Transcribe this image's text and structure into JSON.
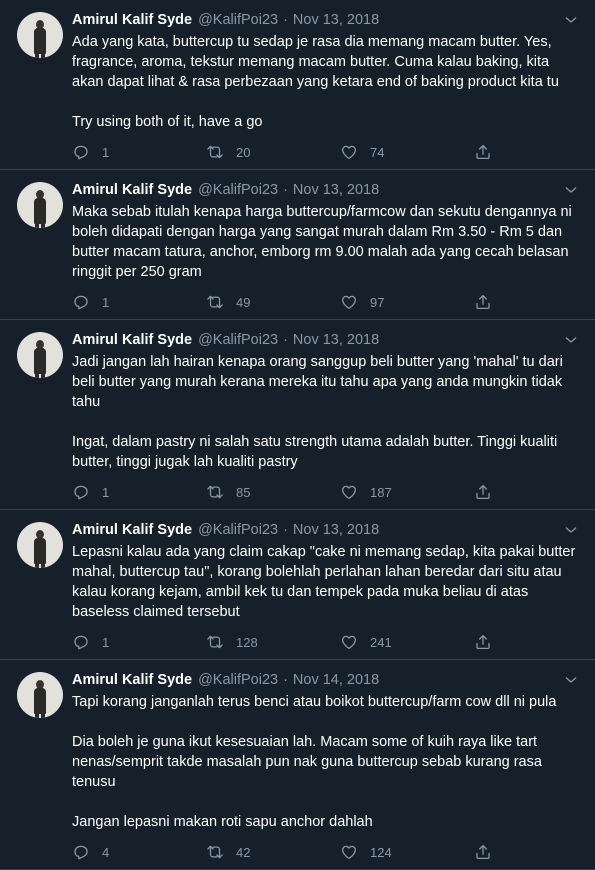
{
  "tweets": [
    {
      "name": "Amirul Kalif Syde",
      "handle": "@KalifPoi23",
      "date": "Nov 13, 2018",
      "paragraphs": [
        "Ada yang kata, buttercup tu sedap je rasa dia memang macam butter. Yes, fragrance, aroma, tekstur memang macam butter. Cuma kalau baking, kita akan dapat lihat & rasa perbezaan yang ketara end of baking product kita tu",
        "Try using both of it, have a go"
      ],
      "replies": "1",
      "retweets": "20",
      "likes": "74"
    },
    {
      "name": "Amirul Kalif Syde",
      "handle": "@KalifPoi23",
      "date": "Nov 13, 2018",
      "paragraphs": [
        "Maka sebab itulah kenapa harga buttercup/farmcow dan sekutu dengannya ni boleh didapati dengan harga yang sangat murah dalam Rm 3.50 - Rm 5 dan butter macam tatura, anchor, emborg rm 9.00 malah ada yang cecah belasan ringgit per 250 gram"
      ],
      "replies": "1",
      "retweets": "49",
      "likes": "97"
    },
    {
      "name": "Amirul Kalif Syde",
      "handle": "@KalifPoi23",
      "date": "Nov 13, 2018",
      "paragraphs": [
        "Jadi jangan lah hairan kenapa orang sanggup beli butter yang 'mahal' tu dari beli butter yang murah kerana mereka itu tahu apa yang anda mungkin tidak tahu",
        "Ingat, dalam pastry ni salah satu strength utama adalah butter. Tinggi kualiti butter, tinggi jugak lah kualiti pastry"
      ],
      "replies": "1",
      "retweets": "85",
      "likes": "187"
    },
    {
      "name": "Amirul Kalif Syde",
      "handle": "@KalifPoi23",
      "date": "Nov 13, 2018",
      "paragraphs": [
        "Lepasni kalau ada yang claim cakap \"cake ni memang sedap, kita pakai butter mahal, buttercup tau\", korang bolehlah perlahan lahan beredar dari situ atau kalau korang kejam, ambil kek tu dan tempek pada muka beliau di atas baseless claimed tersebut"
      ],
      "replies": "1",
      "retweets": "128",
      "likes": "241"
    },
    {
      "name": "Amirul Kalif Syde",
      "handle": "@KalifPoi23",
      "date": "Nov 14, 2018",
      "paragraphs": [
        "Tapi korang janganlah terus benci atau boikot buttercup/farm cow dll ni pula",
        "Dia boleh je guna ikut kesesuaian lah. Macam some of kuih raya like tart nenas/semprit takde masalah pun nak guna buttercup sebab kurang rasa tenusu",
        "Jangan lepasni makan roti sapu anchor dahlah"
      ],
      "replies": "4",
      "retweets": "42",
      "likes": "124"
    }
  ],
  "icons": {
    "reply": "reply-icon",
    "retweet": "retweet-icon",
    "like": "heart-icon",
    "share": "share-icon",
    "menu": "chevron-down-icon"
  },
  "colors": {
    "background": "#15202b",
    "text": "#ffffff",
    "muted": "#8899a6",
    "divider": "#38444d"
  }
}
